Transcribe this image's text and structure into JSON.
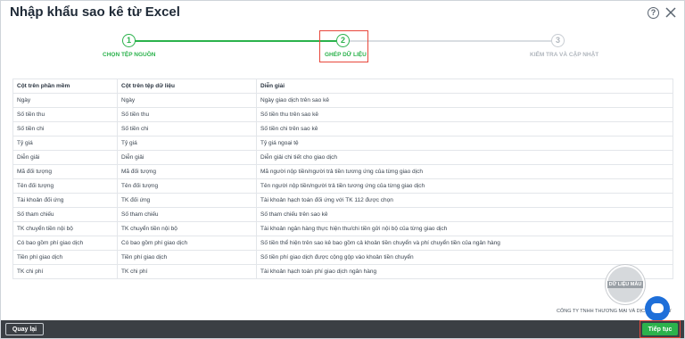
{
  "dialog": {
    "title": "Nhập khẩu sao kê từ Excel",
    "help_icon": "?",
    "close_icon": "close-icon"
  },
  "steps": [
    {
      "number": "1",
      "label": "CHỌN TỆP NGUỒN",
      "state": "done"
    },
    {
      "number": "2",
      "label": "GHÉP DỮ LIỆU",
      "state": "active"
    },
    {
      "number": "3",
      "label": "KIỂM TRA VÀ CẬP NHẬT",
      "state": "pending"
    }
  ],
  "table": {
    "headers": [
      "Cột trên phần mềm",
      "Cột trên tệp dữ liệu",
      "Diễn giải"
    ],
    "rows": [
      [
        "Ngày",
        "Ngày",
        "Ngày giao dịch trên sao kê"
      ],
      [
        "Số tiền thu",
        "Số tiền thu",
        "Số tiền thu trên sao kê"
      ],
      [
        "Số tiền chi",
        "Số tiền chi",
        "Số tiền chi trên sao kê"
      ],
      [
        "Tỷ giá",
        "Tỷ giá",
        "Tỷ giá ngoại tệ"
      ],
      [
        "Diễn giải",
        "Diễn giải",
        "Diễn giải chi tiết cho giao dịch"
      ],
      [
        "Mã đối tượng",
        "Mã đối tượng",
        "Mã người nộp tiền/người trả tiền tương ứng của từng giao dịch"
      ],
      [
        "Tên đối tượng",
        "Tên đối tượng",
        "Tên người nộp tiền/người trả tiền tương ứng của từng giao dịch"
      ],
      [
        "Tài khoản đối ứng",
        "TK đối ứng",
        "Tài khoản hạch toán đối ứng với TK 112 được chọn"
      ],
      [
        "Số tham chiếu",
        "Số tham chiếu",
        "Số tham chiếu trên sao kê"
      ],
      [
        "TK chuyển tiền nội bộ",
        "TK chuyển tiền nội bộ",
        "Tài khoản ngân hàng thực hiện thu/chi tiền gửi nội bộ của từng giao dịch"
      ],
      [
        "Có bao gồm phí giao dịch",
        "Có bao gồm phí giao dịch",
        "Số tiền thể hiện trên sao kê bao gồm cả khoản tiền chuyển và phí chuyển tiền của ngân hàng"
      ],
      [
        "Tiền phí giao dịch",
        "Tiền phí giao dịch",
        "Số tiền phí giao dịch được cộng gộp vào khoản tiền chuyển"
      ],
      [
        "TK chi phí",
        "TK chi phí",
        "Tài khoản hạch toán phí giao dịch ngân hàng"
      ]
    ]
  },
  "watermark": {
    "text": "DỮ LIỆU MẪU"
  },
  "company": {
    "text": "CÔNG TY TNHH THƯƠNG MẠI VÀ DỊCH VỤ ... TW"
  },
  "footer": {
    "back_label": "Quay lại",
    "next_label": "Tiếp tục"
  },
  "colors": {
    "accent_green": "#2bb24c",
    "highlight_red": "#e8473b",
    "footer_bg": "#3b3f44",
    "chat_blue": "#1e6fd9"
  }
}
